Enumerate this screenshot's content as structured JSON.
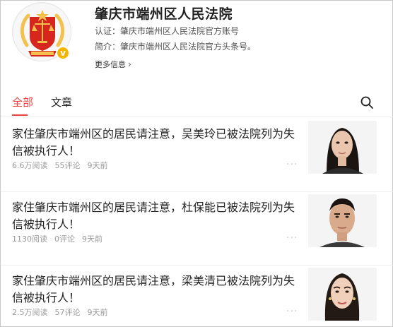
{
  "profile": {
    "name": "肇庆市端州区人民法院",
    "certification": "认证：肇庆市端州区人民法院官方账号",
    "intro": "简介：肇庆市端州区人民法院官方头条号。",
    "more_label": "更多信息"
  },
  "tabs": [
    {
      "label": "全部",
      "active": true
    },
    {
      "label": "文章",
      "active": false
    }
  ],
  "articles": [
    {
      "title": "家住肇庆市端州区的居民请注意，吴美玲已被法院列为失信被执行人！",
      "reads": "6.6万阅读",
      "comments": "55评论",
      "time": "9天前"
    },
    {
      "title": "家住肇庆市端州区的居民请注意，杜保能已被法院列为失信被执行人！",
      "reads": "1130阅读",
      "comments": "0评论",
      "time": "9天前"
    },
    {
      "title": "家住肇庆市端州区的居民请注意，梁美清已被法院列为失信被执行人！",
      "reads": "2.5万阅读",
      "comments": "57评论",
      "time": "9天前"
    }
  ],
  "colors": {
    "accent": "#f04142",
    "badge": "#f5b400",
    "emblem_red": "#d7261d",
    "emblem_gold": "#f2c14e"
  },
  "icons": {
    "avatar": "court-emblem-icon",
    "verified": "verified-badge-icon",
    "search": "search-icon",
    "more": "more-dots-icon"
  }
}
